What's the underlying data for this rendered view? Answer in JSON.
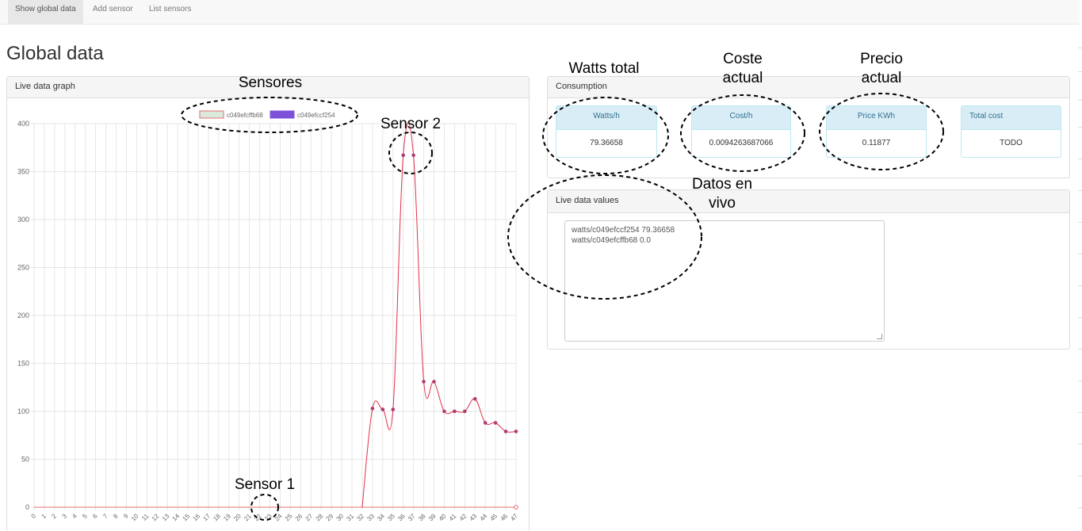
{
  "nav": {
    "tabs": [
      {
        "label": "Show global data",
        "active": true
      },
      {
        "label": "Add sensor",
        "active": false
      },
      {
        "label": "List sensors",
        "active": false
      }
    ]
  },
  "page_title": "Global data",
  "graph_panel": {
    "title": "Live data graph",
    "legend": [
      {
        "label": "c049efcffb68",
        "color": "#dbe8dc",
        "border": "#e07070"
      },
      {
        "label": "c049efccf254",
        "color": "#7d52d9",
        "border": "#7d52d9"
      }
    ]
  },
  "chart_data": {
    "type": "line",
    "title": "",
    "xlabel": "",
    "ylabel": "",
    "x": [
      0,
      1,
      2,
      3,
      4,
      5,
      6,
      7,
      8,
      9,
      10,
      11,
      12,
      13,
      14,
      15,
      16,
      17,
      18,
      19,
      20,
      21,
      22,
      23,
      24,
      25,
      26,
      27,
      28,
      29,
      30,
      31,
      32,
      33,
      34,
      35,
      36,
      37,
      38,
      39,
      40,
      41,
      42,
      43,
      44,
      45,
      46,
      47
    ],
    "ylim": [
      0,
      400
    ],
    "yticks": [
      0,
      50,
      100,
      150,
      200,
      250,
      300,
      350,
      400
    ],
    "grid": true,
    "legend_position": "top",
    "series": [
      {
        "name": "c049efcffb68",
        "color": "#e07070",
        "values": [
          0,
          0,
          0,
          0,
          0,
          0,
          0,
          0,
          0,
          0,
          0,
          0,
          0,
          0,
          0,
          0,
          0,
          0,
          0,
          0,
          0,
          0,
          0,
          0,
          0,
          0,
          0,
          0,
          0,
          0,
          0,
          0,
          0,
          0,
          0,
          0,
          0,
          0,
          0,
          0,
          0,
          0,
          0,
          0,
          0,
          0,
          0,
          0
        ]
      },
      {
        "name": "c049efccf254",
        "color": "#b03a73",
        "values": [
          null,
          null,
          null,
          null,
          null,
          null,
          null,
          null,
          null,
          null,
          null,
          null,
          null,
          null,
          null,
          null,
          null,
          null,
          null,
          null,
          null,
          null,
          null,
          null,
          null,
          null,
          null,
          null,
          null,
          null,
          null,
          null,
          null,
          103,
          102,
          102,
          367,
          367,
          131,
          131,
          100,
          100,
          100,
          113,
          88,
          88,
          79,
          79
        ]
      }
    ]
  },
  "consumption_panel": {
    "title": "Consumption",
    "cards": [
      {
        "label": "Watts/h",
        "value": "79.36658"
      },
      {
        "label": "Cost/h",
        "value": "0.0094263687066"
      },
      {
        "label": "Price KWh",
        "value": "0.11877"
      },
      {
        "label": "Total cost",
        "value": "TODO"
      }
    ]
  },
  "live_values_panel": {
    "title": "Live data values",
    "lines": [
      "watts/c049efccf254 79.36658",
      "watts/c049efcffb68 0.0"
    ]
  },
  "annotations": {
    "sensores": "Sensores",
    "sensor2": "Sensor 2",
    "sensor1": "Sensor 1",
    "watts_total": "Watts total",
    "coste_actual_1": "Coste",
    "coste_actual_2": "actual",
    "precio_actual_1": "Precio",
    "precio_actual_2": "actual",
    "datos_1": "Datos en",
    "datos_2": "vivo"
  }
}
